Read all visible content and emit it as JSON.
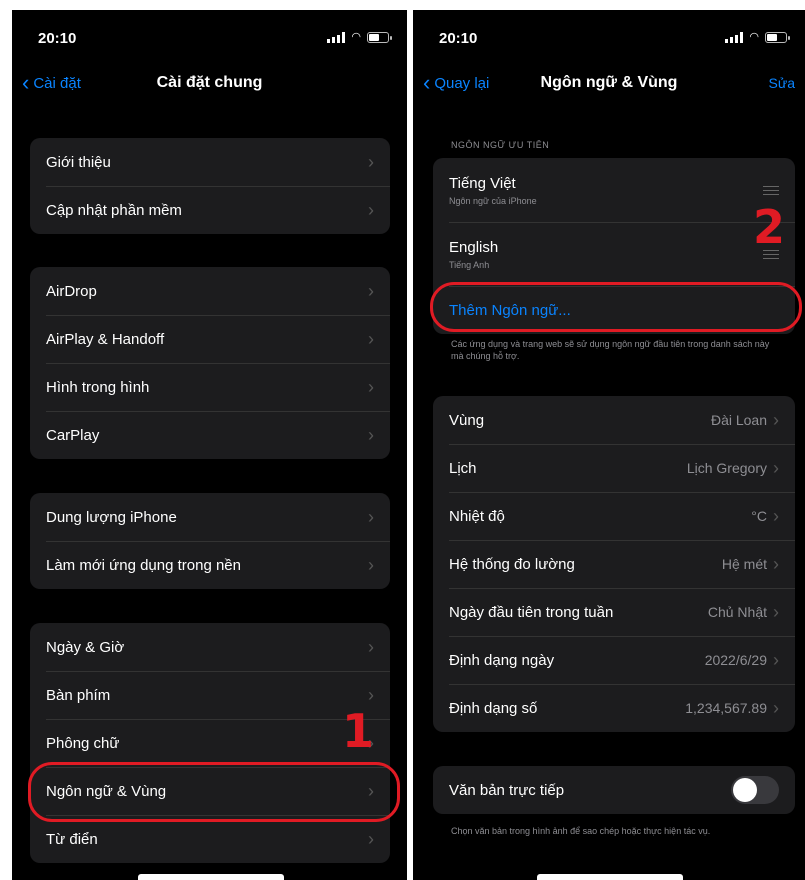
{
  "left": {
    "time": "20:10",
    "back_label": "Cài đặt",
    "title": "Cài đặt chung",
    "groups": [
      [
        "Giới thiệu",
        "Cập nhật phần mềm"
      ],
      [
        "AirDrop",
        "AirPlay & Handoff",
        "Hình trong hình",
        "CarPlay"
      ],
      [
        "Dung lượng iPhone",
        "Làm mới ứng dụng trong nền"
      ],
      [
        "Ngày & Giờ",
        "Bàn phím",
        "Phông chữ",
        "Ngôn ngữ & Vùng",
        "Từ điển"
      ]
    ],
    "step_label": "1"
  },
  "right": {
    "time": "20:10",
    "back_label": "Quay lại",
    "title": "Ngôn ngữ & Vùng",
    "edit_label": "Sửa",
    "preferred_header": "NGÔN NGỮ ƯU TIÊN",
    "languages": [
      {
        "name": "Tiếng Việt",
        "sub": "Ngôn ngữ của iPhone"
      },
      {
        "name": "English",
        "sub": "Tiếng Anh"
      }
    ],
    "add_language": "Thêm Ngôn ngữ...",
    "languages_footnote": "Các ứng dụng và trang web sẽ sử dụng ngôn ngữ đầu tiên trong danh sách này mà chúng hỗ trợ.",
    "region_rows": [
      {
        "label": "Vùng",
        "value": "Đài Loan"
      },
      {
        "label": "Lịch",
        "value": "Lịch Gregory"
      },
      {
        "label": "Nhiệt độ",
        "value": "°C"
      },
      {
        "label": "Hệ thống đo lường",
        "value": "Hệ mét"
      },
      {
        "label": "Ngày đầu tiên trong tuần",
        "value": "Chủ Nhật"
      },
      {
        "label": "Định dạng ngày",
        "value": "2022/6/29"
      },
      {
        "label": "Định dạng số",
        "value": "1,234,567.89"
      }
    ],
    "live_text_label": "Văn bản trực tiếp",
    "live_text_footnote": "Chọn văn bản trong hình ảnh để sao chép hoặc thực hiện tác vụ.",
    "step_label": "2"
  },
  "colors": {
    "accent": "#0a84ff",
    "highlight": "#e01b24",
    "cell_bg": "#1c1c1e"
  }
}
